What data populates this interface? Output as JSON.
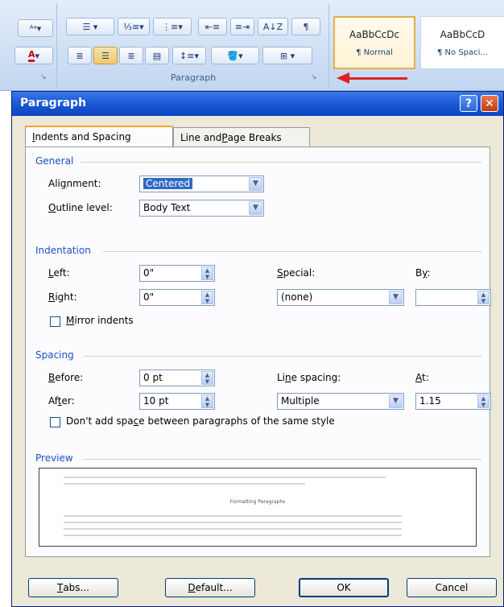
{
  "ribbon": {
    "group_label": "Paragraph",
    "styles": [
      {
        "sample": "AaBbCcDc",
        "name": "¶ Normal"
      },
      {
        "sample": "AaBbCcD",
        "name": "¶ No Spaci..."
      }
    ]
  },
  "dialog": {
    "title": "Paragraph",
    "help_glyph": "?",
    "close_glyph": "✕",
    "tabs": [
      {
        "pre": "",
        "key": "I",
        "post": "ndents and Spacing"
      },
      {
        "pre": "Line and ",
        "key": "P",
        "post": "age Breaks"
      }
    ],
    "general": {
      "heading": "General",
      "alignment_label": {
        "pre": "Ali",
        "key": "g",
        "post": "nment:"
      },
      "alignment_value": "Centered",
      "outline_label": {
        "pre": "",
        "key": "O",
        "post": "utline level:"
      },
      "outline_value": "Body Text"
    },
    "indentation": {
      "heading": "Indentation",
      "left_label": {
        "pre": "",
        "key": "L",
        "post": "eft:"
      },
      "left_value": "0\"",
      "right_label": {
        "pre": "",
        "key": "R",
        "post": "ight:"
      },
      "right_value": "0\"",
      "special_label": {
        "pre": "",
        "key": "S",
        "post": "pecial:"
      },
      "special_value": "(none)",
      "by_label": {
        "pre": "B",
        "key": "y",
        "post": ":"
      },
      "by_value": "",
      "mirror_label": {
        "pre": "",
        "key": "M",
        "post": "irror indents"
      }
    },
    "spacing": {
      "heading": "Spacing",
      "before_label": {
        "pre": "",
        "key": "B",
        "post": "efore:"
      },
      "before_value": "0 pt",
      "after_label": {
        "pre": "Af",
        "key": "t",
        "post": "er:"
      },
      "after_value": "10 pt",
      "line_label": {
        "pre": "Li",
        "key": "n",
        "post": "e spacing:"
      },
      "line_value": "Multiple",
      "at_label": {
        "pre": "",
        "key": "A",
        "post": "t:"
      },
      "at_value": "1.15",
      "dont_add_label": {
        "pre": "Don't add spa",
        "key": "c",
        "post": "e between paragraphs of the same style"
      }
    },
    "preview": {
      "heading": "Preview",
      "sample_heading": "Formatting Paragraphs"
    },
    "buttons": {
      "tabs": {
        "pre": "",
        "key": "T",
        "post": "abs..."
      },
      "default": {
        "pre": "",
        "key": "D",
        "post": "efault..."
      },
      "ok": "OK",
      "cancel": "Cancel"
    }
  },
  "colors": {
    "title_bar": "#1e5bd6",
    "section_heading": "#1c4fbf",
    "selection": "#316ac5",
    "callout_arrow": "#e02020"
  }
}
